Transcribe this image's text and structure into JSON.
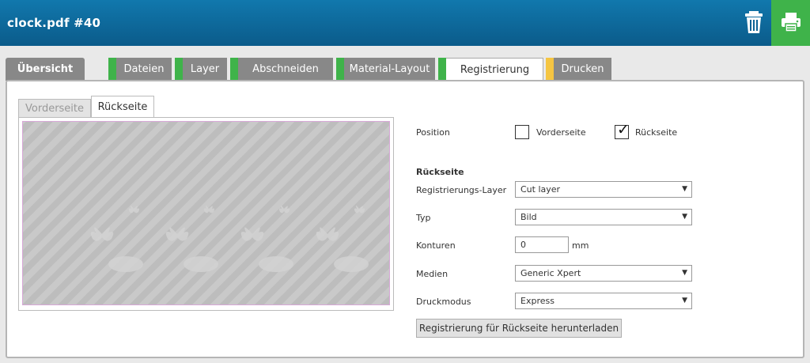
{
  "header": {
    "title": "clock.pdf #40",
    "trash_icon": "trash-icon",
    "print_icon": "printer-icon",
    "accent": "#3fb34a"
  },
  "tabs": [
    {
      "label": "Übersicht",
      "stripe": ""
    },
    {
      "label": "Dateien",
      "stripe": "#3fb34a"
    },
    {
      "label": "Layer",
      "stripe": "#3fb34a"
    },
    {
      "label": "Abschneiden",
      "stripe": "#3fb34a"
    },
    {
      "label": "Material-Layout",
      "stripe": "#3fb34a"
    },
    {
      "label": "Registrierung",
      "stripe": "#3fb34a"
    },
    {
      "label": "Drucken",
      "stripe": "#f5c542"
    }
  ],
  "subtabs": {
    "front": "Vorderseite",
    "back": "Rückseite"
  },
  "form": {
    "position_label": "Position",
    "front_option": "Vorderseite",
    "back_option": "Rückseite",
    "front_checked": false,
    "back_checked": true,
    "section_title": "Rückseite",
    "layer_label": "Registrierungs-Layer",
    "layer_value": "Cut layer",
    "type_label": "Typ",
    "type_value": "Bild",
    "contour_label": "Konturen",
    "contour_value": "0",
    "contour_unit": "mm",
    "media_label": "Medien",
    "media_value": "Generic Xpert",
    "mode_label": "Druckmodus",
    "mode_value": "Express"
  },
  "download_button": "Registrierung für Rückseite herunterladen"
}
